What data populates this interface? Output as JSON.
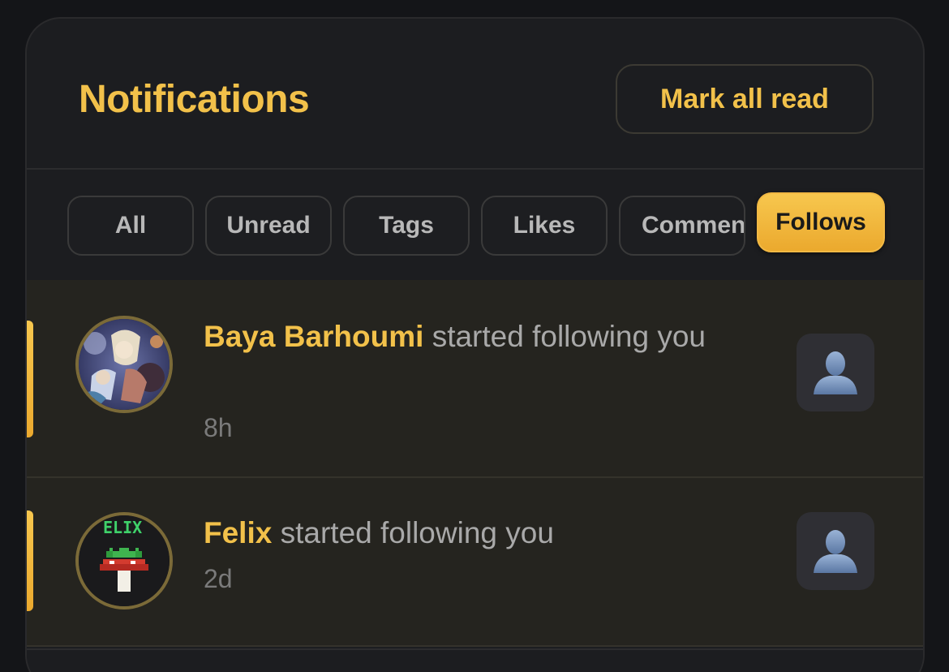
{
  "header": {
    "title": "Notifications",
    "mark_all_label": "Mark all read"
  },
  "tabs": [
    {
      "label": "All",
      "active": false
    },
    {
      "label": "Unread",
      "active": false
    },
    {
      "label": "Tags",
      "active": false
    },
    {
      "label": "Likes",
      "active": false
    },
    {
      "label": "Comments",
      "active": false
    },
    {
      "label": "Follows",
      "active": true
    }
  ],
  "notifications": [
    {
      "name": "Baya Barhoumi",
      "action": "started following you",
      "time": "8h",
      "unread": true,
      "avatar_icon": "anime-artwork-avatar",
      "action_icon": "user-profile-icon"
    },
    {
      "name": "Felix",
      "action": "started following you",
      "time": "2d",
      "unread": true,
      "avatar_icon": "pixel-frog-mushroom-avatar",
      "avatar_text": "ELIX",
      "action_icon": "user-profile-icon"
    }
  ],
  "colors": {
    "accent": "#f2c14a",
    "panel": "#1c1d20",
    "row_unread": "#25241f",
    "muted_text": "#a9a9a9"
  }
}
